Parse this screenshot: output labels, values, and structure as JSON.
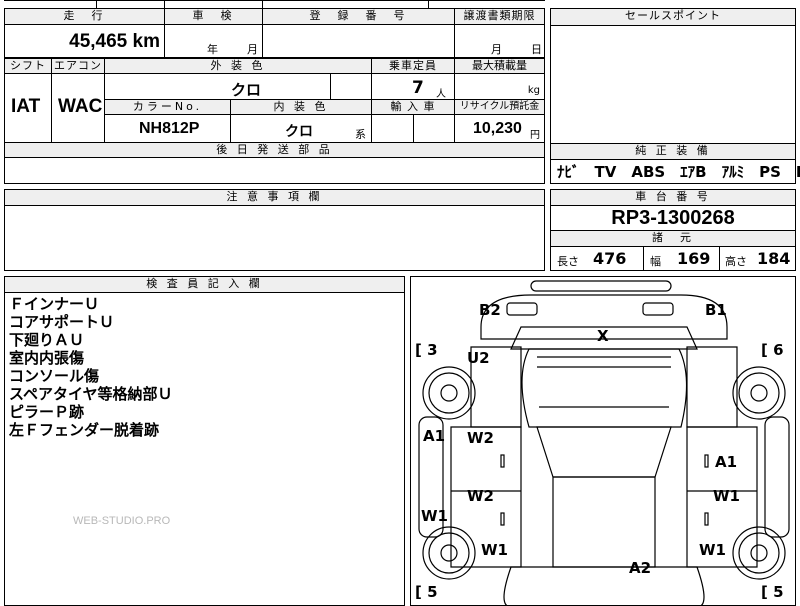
{
  "top_left": {
    "mileage_header": "走　行",
    "mileage_value": "45,465 km",
    "inspection_header": "車　検",
    "inspection_year": "年",
    "inspection_month": "月",
    "registration_header": "登　録　番　号",
    "transfer_header": "譲渡書類期限",
    "transfer_month": "月",
    "transfer_day": "日",
    "shift_header": "シフト",
    "ac_header": "エアコン",
    "exterior_header": "外 装 色",
    "capacity_header": "乗車定員",
    "max_load_header": "最大積載量",
    "shift_value": "IAT",
    "ac_value": "WAC",
    "exterior_value": "クロ",
    "capacity_value": "7",
    "capacity_unit": "人",
    "max_load_unit": "kg",
    "color_no_header": "カラーNo.",
    "interior_header": "内 装 色",
    "import_header": "輸 入 車",
    "recycle_header": "リサイクル預託金",
    "color_no_value": "NH812P",
    "interior_value": "クロ",
    "interior_suffix": "系",
    "recycle_value": "10,230",
    "recycle_unit": "円",
    "later_parts_header": "後 日 発 送 部 品"
  },
  "sales_point": {
    "header": "セールスポイント"
  },
  "equipment": {
    "header": "純 正 装 備",
    "items": "ﾅﾋﾞ　TV　ABS　ｴｱB　ｱﾙﾐ　PS　PW"
  },
  "caution": {
    "header": "注 意 事 項 欄"
  },
  "chassis": {
    "header": "車 台 番 号",
    "value": "RP3-1300268",
    "spec_header": "諸　元",
    "length_label": "長さ",
    "length_value": "476",
    "width_label": "幅",
    "width_value": "169",
    "height_label": "高さ",
    "height_value": "184"
  },
  "inspector": {
    "header": "検 査 員 記 入 欄",
    "notes": [
      "ＦインナーＵ",
      "コアサポートＵ",
      "下廻りＡＵ",
      "室内内張傷",
      "コンソール傷",
      "スペアタイヤ等格納部Ｕ",
      "ピラーＰ跡",
      "左Ｆフェンダー脱着跡"
    ],
    "watermark": "WEB-STUDIO.PRO"
  },
  "diagram": {
    "marks": {
      "b2": "B2",
      "b1": "B1",
      "x": "X",
      "u2": "U2",
      "bracket_left_top": "[ 3",
      "bracket_right_top": "[ 6",
      "a1_left": "A1",
      "w2_upper": "W2",
      "a1_right": "A1",
      "w2_lower": "W2",
      "w1_right_mid": "W1",
      "w1_left": "W1",
      "w1_left_inner": "W1",
      "w1_right_lower": "W1",
      "a2": "A2",
      "bracket_left_bottom": "[ 5",
      "bracket_right_bottom": "[ 5"
    }
  }
}
